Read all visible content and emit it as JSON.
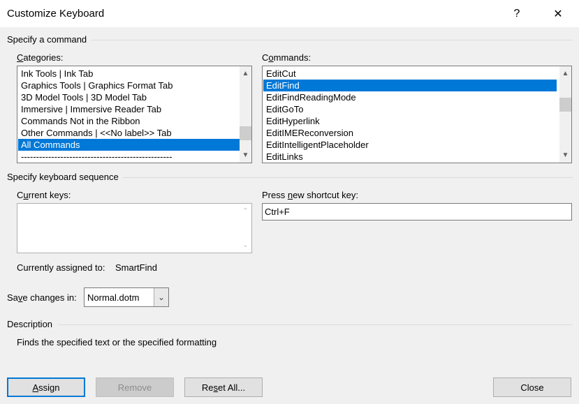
{
  "window": {
    "title": "Customize Keyboard",
    "help_glyph": "?",
    "close_glyph": "✕"
  },
  "specify_command": {
    "group_label": "Specify a command",
    "categories": {
      "label_prefix": "",
      "label_key": "C",
      "label_rest": "ategories:",
      "items": [
        "Ink Tools | Ink Tab",
        "Graphics Tools | Graphics Format Tab",
        "3D Model Tools | 3D Model Tab",
        "Immersive | Immersive Reader Tab",
        "Commands Not in the Ribbon",
        "Other Commands | <<No label>> Tab",
        "All Commands",
        "--------------------------------------------------"
      ],
      "selected_index": 6
    },
    "commands": {
      "label_prefix": "C",
      "label_key": "o",
      "label_rest": "mmands:",
      "items": [
        "EditCut",
        "EditFind",
        "EditFindReadingMode",
        "EditGoTo",
        "EditHyperlink",
        "EditIMEReconversion",
        "EditIntelligentPlaceholder",
        "EditLinks"
      ],
      "selected_index": 1
    }
  },
  "keyboard_sequence": {
    "group_label": "Specify keyboard sequence",
    "current_keys": {
      "label_prefix": "C",
      "label_key": "u",
      "label_rest": "rrent keys:",
      "items": []
    },
    "new_shortcut": {
      "label_prefix": "Press ",
      "label_key": "n",
      "label_rest": "ew shortcut key:",
      "value": "Ctrl+F"
    },
    "currently_assigned_label": "Currently assigned to:",
    "currently_assigned_value": "SmartFind"
  },
  "save_changes": {
    "label_prefix": "Sa",
    "label_key": "v",
    "label_rest": "e changes in:",
    "selected": "Normal.dotm"
  },
  "description": {
    "group_label": "Description",
    "text": "Finds the specified text or the specified formatting"
  },
  "buttons": {
    "assign": {
      "key": "A",
      "rest": "ssign"
    },
    "remove": "Remove",
    "reset_all": {
      "prefix": "Re",
      "key": "s",
      "rest": "et All..."
    },
    "close": "Close"
  }
}
